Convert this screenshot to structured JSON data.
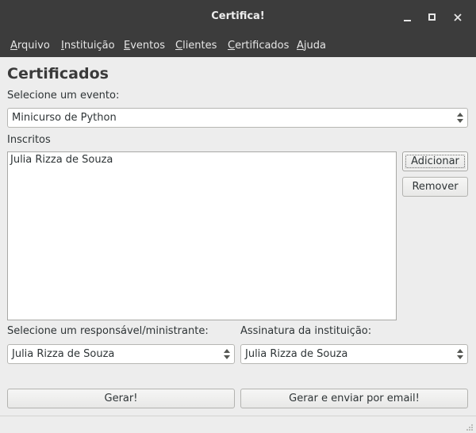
{
  "window": {
    "title": "Certifica!"
  },
  "menu": [
    {
      "label": "Arquivo",
      "mnemonic": "A",
      "rest": "rquivo"
    },
    {
      "label": "Instituição",
      "mnemonic": "I",
      "rest": "nstituição"
    },
    {
      "label": "Eventos",
      "mnemonic": "E",
      "rest": "ventos"
    },
    {
      "label": "Clientes",
      "mnemonic": "C",
      "rest": "lientes"
    },
    {
      "label": "Certificados",
      "mnemonic": "C",
      "rest": "ertificados"
    },
    {
      "label": "Ajuda",
      "mnemonic": "A",
      "rest": "juda"
    }
  ],
  "page": {
    "heading": "Certificados",
    "event_label": "Selecione um evento:",
    "event_value": "Minicurso de Python",
    "inscritos_label": "Inscritos",
    "inscritos": [
      "Julia Rizza de Souza"
    ],
    "add_button": "Adicionar",
    "remove_button": "Remover",
    "responsavel_label": "Selecione um responsável/ministrante:",
    "responsavel_value": "Julia Rizza de Souza",
    "assinatura_label": "Assinatura da instituição:",
    "assinatura_value": "Julia Rizza de Souza",
    "gerar_button": "Gerar!",
    "gerar_email_button": "Gerar e enviar por email!"
  },
  "icons": {
    "minimize": "minimize-icon",
    "maximize": "maximize-icon",
    "close": "close-icon",
    "combo_arrows": "up-down-arrows-icon",
    "resize_grip": "resize-grip-icon"
  }
}
